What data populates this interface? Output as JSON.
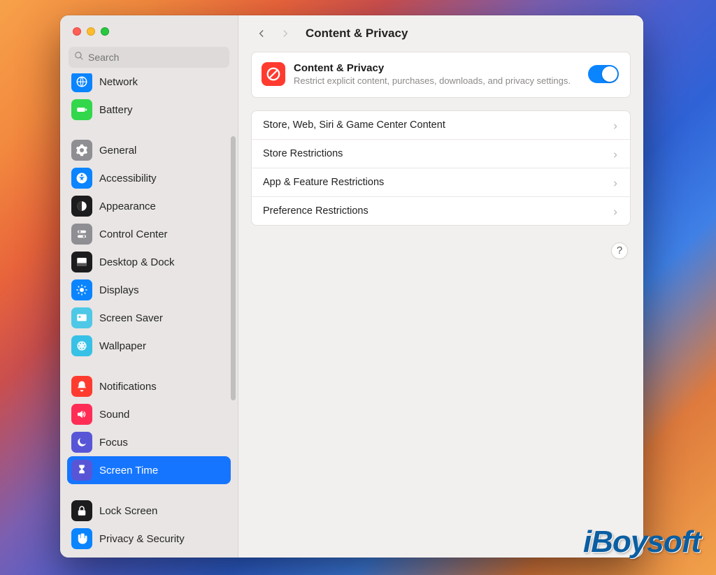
{
  "window": {
    "title": "Content & Privacy",
    "search_placeholder": "Search"
  },
  "sidebar": {
    "items": [
      {
        "label": "Network",
        "iconBg": "#0a84ff",
        "iconKey": "globe"
      },
      {
        "label": "Battery",
        "iconBg": "#32d74b",
        "iconKey": "battery"
      },
      {
        "gap": true
      },
      {
        "label": "General",
        "iconBg": "#8e8e93",
        "iconKey": "gear"
      },
      {
        "label": "Accessibility",
        "iconBg": "#0a84ff",
        "iconKey": "accessibility"
      },
      {
        "label": "Appearance",
        "iconBg": "#1c1c1e",
        "iconKey": "appearance"
      },
      {
        "label": "Control Center",
        "iconBg": "#8e8e93",
        "iconKey": "controls"
      },
      {
        "label": "Desktop & Dock",
        "iconBg": "#1c1c1e",
        "iconKey": "dock"
      },
      {
        "label": "Displays",
        "iconBg": "#0a84ff",
        "iconKey": "brightness"
      },
      {
        "label": "Screen Saver",
        "iconBg": "#4ec8e6",
        "iconKey": "screensaver"
      },
      {
        "label": "Wallpaper",
        "iconBg": "#37c1e6",
        "iconKey": "wallpaper"
      },
      {
        "gap": true
      },
      {
        "label": "Notifications",
        "iconBg": "#ff3b30",
        "iconKey": "bell"
      },
      {
        "label": "Sound",
        "iconBg": "#ff2d55",
        "iconKey": "speaker"
      },
      {
        "label": "Focus",
        "iconBg": "#5856d6",
        "iconKey": "moon"
      },
      {
        "label": "Screen Time",
        "iconBg": "#5856d6",
        "iconKey": "hourglass",
        "selected": true
      },
      {
        "gap": true
      },
      {
        "label": "Lock Screen",
        "iconBg": "#1c1c1e",
        "iconKey": "lock"
      },
      {
        "label": "Privacy & Security",
        "iconBg": "#0a84ff",
        "iconKey": "hand"
      }
    ]
  },
  "header_card": {
    "title": "Content & Privacy",
    "subtitle": "Restrict explicit content, purchases, downloads, and privacy settings.",
    "toggle_on": true
  },
  "rows": [
    {
      "label": "Store, Web, Siri & Game Center Content"
    },
    {
      "label": "Store Restrictions"
    },
    {
      "label": "App & Feature Restrictions"
    },
    {
      "label": "Preference Restrictions"
    }
  ],
  "help_glyph": "?",
  "watermark": "iBoysoft"
}
